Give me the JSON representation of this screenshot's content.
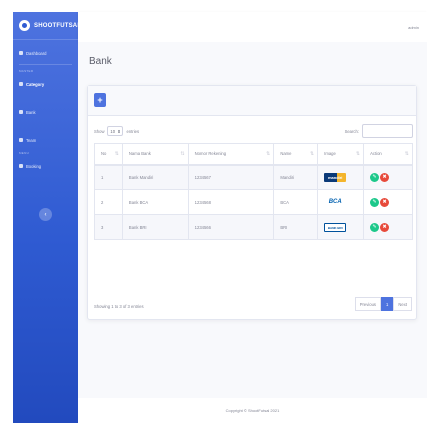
{
  "sidebar": {
    "brand": "SHOOTFUTSAL",
    "items": [
      {
        "label": "Dashboard",
        "icon": "dashboard-icon"
      },
      {
        "label": "Category",
        "icon": "category-icon"
      },
      {
        "label": "Bank",
        "icon": "bank-icon"
      },
      {
        "label": "Team",
        "icon": "team-icon"
      },
      {
        "label": "Booking",
        "icon": "booking-icon"
      }
    ],
    "headings": [
      "MASTER",
      "MENU"
    ],
    "toggle_glyph": "‹"
  },
  "topbar": {
    "user": "admin"
  },
  "page": {
    "title": "Bank",
    "add_glyph": "+"
  },
  "table": {
    "show_label": "Show",
    "entries_label": "entries",
    "length_value": "10",
    "search_label": "Search:",
    "columns": [
      "No",
      "Nama Bank",
      "Nomor Rekening",
      "Name",
      "Image",
      "Action"
    ],
    "rows": [
      {
        "no": "1",
        "bank": "Bank Mandiri",
        "rekening": "1234567",
        "name": "Mandiri",
        "logo": "mandiri"
      },
      {
        "no": "2",
        "bank": "Bank BCA",
        "rekening": "1234568",
        "name": "BCA",
        "logo": "BCA"
      },
      {
        "no": "3",
        "bank": "Bank BRI",
        "rekening": "1234566",
        "name": "BRI",
        "logo": "BANK BRI"
      }
    ],
    "info": "Showing 1 to 3 of 3 entries",
    "pager": {
      "previous": "Previous",
      "current": "1",
      "next": "Next"
    }
  },
  "footer": "Copyright © ShootFutsal 2021",
  "colors": {
    "primary": "#4e73df",
    "success": "#1cc88a",
    "danger": "#e74a3b"
  }
}
